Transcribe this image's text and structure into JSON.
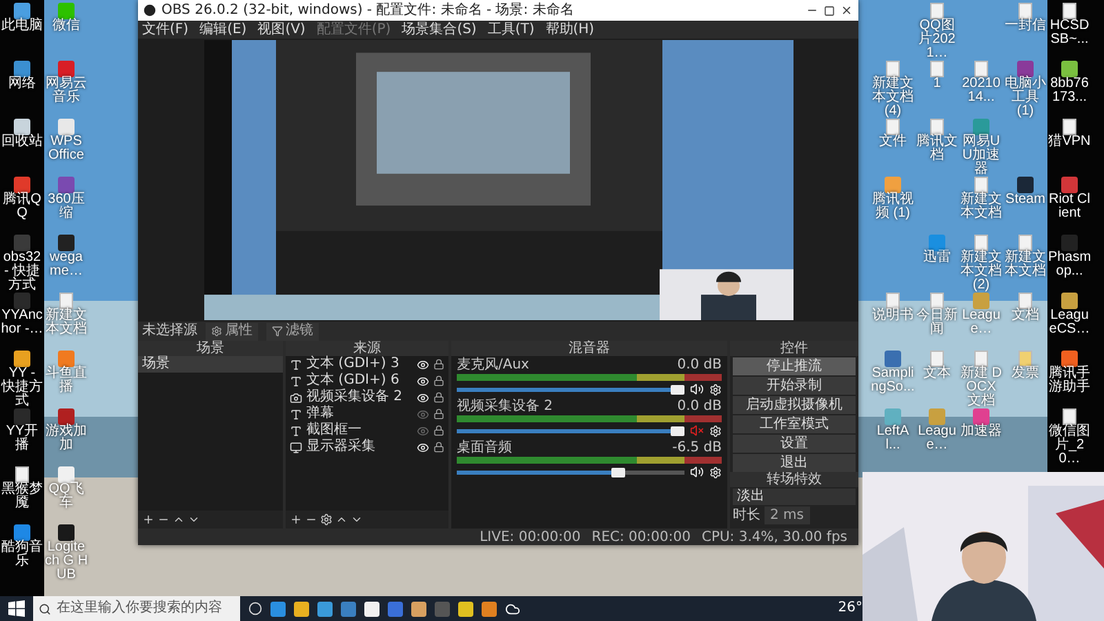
{
  "desktop": {
    "left_columns": [
      [
        {
          "label": "此电脑",
          "kind": "app",
          "color": "#4a9ee0"
        },
        {
          "label": "网络",
          "kind": "app",
          "color": "#3b8fd0"
        },
        {
          "label": "回收站",
          "kind": "app",
          "color": "#c8d4dc"
        },
        {
          "label": "腾讯QQ",
          "kind": "app",
          "color": "#e03a2a"
        },
        {
          "label": "obs32 - 快捷方式",
          "kind": "app",
          "color": "#3a3a3a"
        },
        {
          "label": "YYAnchor -…",
          "kind": "app",
          "color": "#2a2a2a"
        },
        {
          "label": "YY - 快捷方式",
          "kind": "app",
          "color": "#e8a020"
        },
        {
          "label": "YY开播",
          "kind": "app",
          "color": "#2a2a2a"
        },
        {
          "label": "黑猴梦魇",
          "kind": "file",
          "color": "#f2f2f2"
        },
        {
          "label": "酷狗音乐",
          "kind": "app",
          "color": "#1e88e5"
        }
      ],
      [
        {
          "label": "微信",
          "kind": "app",
          "color": "#2dc100"
        },
        {
          "label": "网易云音乐",
          "kind": "app",
          "color": "#d81e26"
        },
        {
          "label": "WPS Office",
          "kind": "app",
          "color": "#e8e8e8"
        },
        {
          "label": "360压缩",
          "kind": "app",
          "color": "#7a4ab0"
        },
        {
          "label": "wegame…",
          "kind": "app",
          "color": "#222222"
        },
        {
          "label": "新建文本文档",
          "kind": "file",
          "color": "#f2f2f2"
        },
        {
          "label": "斗鱼直播",
          "kind": "app",
          "color": "#f07a20"
        },
        {
          "label": "游戏加加",
          "kind": "app",
          "color": "#b02020"
        },
        {
          "label": "QQ飞车",
          "kind": "app",
          "color": "#f0f0f0"
        },
        {
          "label": "Logitech G HUB",
          "kind": "app",
          "color": "#1a1a1a"
        }
      ]
    ],
    "right_columns": [
      [
        null,
        {
          "label": "新建文本文档 (4)",
          "kind": "file",
          "color": "#f2f2f2"
        },
        {
          "label": "文件",
          "kind": "file",
          "color": "#f2f2f2"
        },
        {
          "label": "腾讯视频 (1)",
          "kind": "app",
          "color": "#f0a040"
        },
        null,
        {
          "label": "说明书",
          "kind": "file",
          "color": "#f2f2f2"
        },
        {
          "label": "SamplingSo...",
          "kind": "app",
          "color": "#3a6fb0"
        },
        {
          "label": "LeftAl...",
          "kind": "app",
          "color": "#60b0c0"
        }
      ],
      [
        {
          "label": "QQ图片2021…",
          "kind": "file",
          "color": "#f2f2f2"
        },
        {
          "label": "1",
          "kind": "file",
          "color": "#f2f2f2"
        },
        {
          "label": "腾讯文档",
          "kind": "file",
          "color": "#f2f2f2"
        },
        null,
        {
          "label": "迅雷",
          "kind": "app",
          "color": "#1a8fe0"
        },
        {
          "label": "今日新闻",
          "kind": "file",
          "color": "#f2f2f2"
        },
        {
          "label": "文本",
          "kind": "file",
          "color": "#f2f2f2"
        },
        {
          "label": "League…",
          "kind": "app",
          "color": "#c8a040"
        }
      ],
      [
        null,
        {
          "label": "2021014...",
          "kind": "file",
          "color": "#f2f2f2"
        },
        {
          "label": "网易UU加速器",
          "kind": "app",
          "color": "#2a9a9a"
        },
        {
          "label": "新建文本文档",
          "kind": "file",
          "color": "#f2f2f2"
        },
        {
          "label": "新建文本文档 (2)",
          "kind": "file",
          "color": "#f2f2f2"
        },
        {
          "label": "League…",
          "kind": "app",
          "color": "#c8a040"
        },
        {
          "label": "新建 DOCX 文档",
          "kind": "file",
          "color": "#f2f2f2"
        },
        {
          "label": "加速器",
          "kind": "app",
          "color": "#e04090"
        }
      ],
      [
        {
          "label": "一封信",
          "kind": "file",
          "color": "#f2f2f2"
        },
        {
          "label": "电脑小工具 (1)",
          "kind": "app",
          "color": "#8a3a9a"
        },
        null,
        {
          "label": "Steam",
          "kind": "app",
          "color": "#1b2838"
        },
        {
          "label": "新建文本文档",
          "kind": "file",
          "color": "#f2f2f2"
        },
        {
          "label": "文档",
          "kind": "file",
          "color": "#f2f2f2"
        },
        {
          "label": "发票",
          "kind": "file",
          "color": "#f0d070"
        },
        null
      ],
      [
        {
          "label": "HCSDSB~...",
          "kind": "file",
          "color": "#f2f2f2"
        },
        {
          "label": "8bb76173...",
          "kind": "app",
          "color": "#7ac040"
        },
        {
          "label": "猎VPN",
          "kind": "file",
          "color": "#f2f2f2"
        },
        {
          "label": "Riot Client",
          "kind": "app",
          "color": "#d13639"
        },
        {
          "label": "Phasmop...",
          "kind": "app",
          "color": "#222222"
        },
        {
          "label": "LeagueCS…",
          "kind": "app",
          "color": "#c8a040"
        },
        {
          "label": "腾讯手游助手",
          "kind": "app",
          "color": "#f06020"
        },
        {
          "label": "微信图片_20…",
          "kind": "file",
          "color": "#f2f2f2"
        }
      ]
    ]
  },
  "obs": {
    "title": "OBS 26.0.2 (32-bit, windows) - 配置文件: 未命名 - 场景: 未命名",
    "menu": [
      {
        "label": "文件(F)",
        "disabled": false
      },
      {
        "label": "编辑(E)",
        "disabled": false
      },
      {
        "label": "视图(V)",
        "disabled": false
      },
      {
        "label": "配置文件(P)",
        "disabled": true
      },
      {
        "label": "场景集合(S)",
        "disabled": false
      },
      {
        "label": "工具(T)",
        "disabled": false
      },
      {
        "label": "帮助(H)",
        "disabled": false
      }
    ],
    "source_bar": {
      "label": "未选择源",
      "buttons": [
        "属性",
        "滤镜"
      ]
    },
    "scenes": {
      "title": "场景",
      "items": [
        {
          "label": "场景",
          "selected": true
        }
      ]
    },
    "sources": {
      "title": "来源",
      "items": [
        {
          "label": "文本 (GDI+) 3",
          "kind": "text",
          "visible": true
        },
        {
          "label": "文本 (GDI+) 6",
          "kind": "text",
          "visible": true
        },
        {
          "label": "视频采集设备 2",
          "kind": "camera",
          "visible": true
        },
        {
          "label": "弹幕",
          "kind": "text",
          "visible": false
        },
        {
          "label": "截图框一",
          "kind": "text",
          "visible": false
        },
        {
          "label": "显示器采集",
          "kind": "monitor",
          "visible": true
        }
      ]
    },
    "mixer": {
      "title": "混音器",
      "channels": [
        {
          "name": "麦克风/Aux",
          "reading": "0.0 dB",
          "level": 1,
          "muted": false
        },
        {
          "name": "视频采集设备 2",
          "reading": "0.0 dB",
          "level": 1,
          "muted": true
        },
        {
          "name": "桌面音频",
          "reading": "-6.5 dB",
          "level": 0.72,
          "muted": false
        }
      ]
    },
    "controls": {
      "title": "控件",
      "buttons": [
        {
          "label": "停止推流",
          "active": true
        },
        {
          "label": "开始录制",
          "active": false
        },
        {
          "label": "启动虚拟摄像机",
          "active": false
        },
        {
          "label": "工作室模式",
          "active": false
        },
        {
          "label": "设置",
          "active": false
        },
        {
          "label": "退出",
          "active": false
        }
      ]
    },
    "transitions": {
      "title": "转场特效",
      "effect": "淡出",
      "duration_label": "时长",
      "duration": "2 ms"
    },
    "status": {
      "live": "LIVE: 00:00:00",
      "rec": "REC: 00:00:00",
      "cpu": "CPU: 3.4%, 30.00 fps"
    }
  },
  "taskbar": {
    "search_placeholder": "在这里输入你要搜索的内容",
    "weather": "26°"
  }
}
